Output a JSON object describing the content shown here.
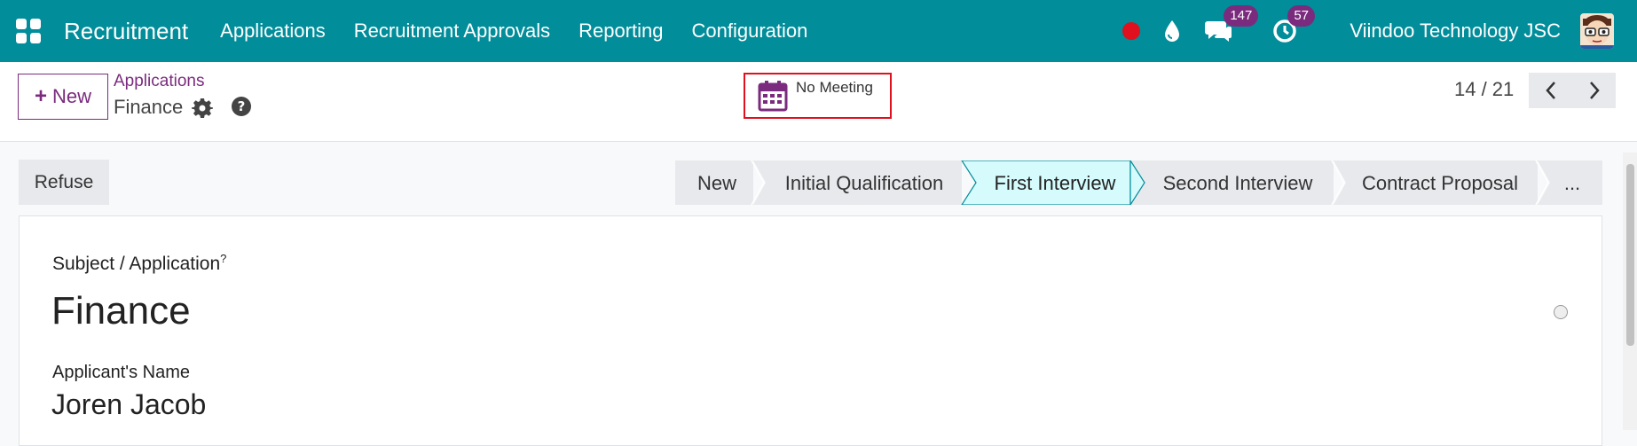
{
  "navbar": {
    "app_name": "Recruitment",
    "menu": [
      "Applications",
      "Recruitment Approvals",
      "Reporting",
      "Configuration"
    ],
    "messages_count": "147",
    "activities_count": "57",
    "company": "Viindoo Technology JSC",
    "icons": [
      "apps-grid-icon",
      "record-icon",
      "drop-icon",
      "chat-icon",
      "activity-clock-icon"
    ],
    "colors": {
      "bar": "#018d9a",
      "badge": "#7b2b7e",
      "record": "#e0101e"
    }
  },
  "control": {
    "new_label": "New",
    "breadcrumb_parent": "Applications",
    "breadcrumb_current": "Finance",
    "meeting_label": "No Meeting",
    "pager": "14 / 21"
  },
  "statusbar": {
    "refuse_label": "Refuse",
    "stages": [
      "New",
      "Initial Qualification",
      "First Interview",
      "Second Interview",
      "Contract Proposal",
      "..."
    ],
    "active_stage": "First Interview",
    "active_color": "#d5fbfc"
  },
  "form": {
    "subject_label": "Subject / Application",
    "subject_help": "?",
    "subject_value": "Finance",
    "applicant_label": "Applicant's Name",
    "applicant_value": "Joren Jacob"
  }
}
